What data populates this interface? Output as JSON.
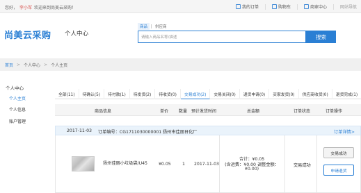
{
  "topbar": {
    "greeting_prefix": "您好，",
    "username": "李小军",
    "welcome": "欢迎来到尚美云采购！",
    "links": [
      "我的订单",
      "购物车",
      "商家中心",
      "网站导航"
    ]
  },
  "header": {
    "logo": "尚美云采购",
    "section_title": "个人中心",
    "search_tabs": [
      "商品",
      "供应商"
    ],
    "search_placeholder": "请输入商品名称/描述",
    "search_button": "搜索"
  },
  "breadcrumb": [
    "首页",
    "个人中心",
    "个人主页"
  ],
  "sidebar": {
    "title": "个人中心",
    "items": [
      "个人主页",
      "个人信息",
      "账户管理"
    ]
  },
  "order_tabs": [
    "全部(11)",
    "待确认(5)",
    "待付款(1)",
    "待发货(2)",
    "待收货(0)",
    "交易成功(2)",
    "交易关闭(0)",
    "退货申请(0)",
    "买家发货(0)",
    "供应商收货(0)",
    "退货完成(1)"
  ],
  "table_headers": [
    "商品信息",
    "单价",
    "数量",
    "预计发货时间",
    "总金额",
    "订单状态",
    "订单操作"
  ],
  "order": {
    "date": "2017-11-03",
    "number_label": "订单编号：CG1711030000001",
    "supplier": "扬州市佳丽日化厂",
    "detail_link": "订单详情>",
    "product_name": "扬州佳丽小垃圾袋/U45",
    "unit_price": "¥0.05",
    "quantity": "1",
    "ship_date": "2017-11-03",
    "total_line1": "合计：¥0.05",
    "total_line2": "(含运费：¥0.00 调整金额：",
    "total_line3": "¥0.00)",
    "status": "交易成功",
    "action_primary": "交易成功",
    "action_secondary": "申请退货"
  },
  "colors": {
    "accent": "#2a7fd4",
    "user": "#d9534f"
  }
}
